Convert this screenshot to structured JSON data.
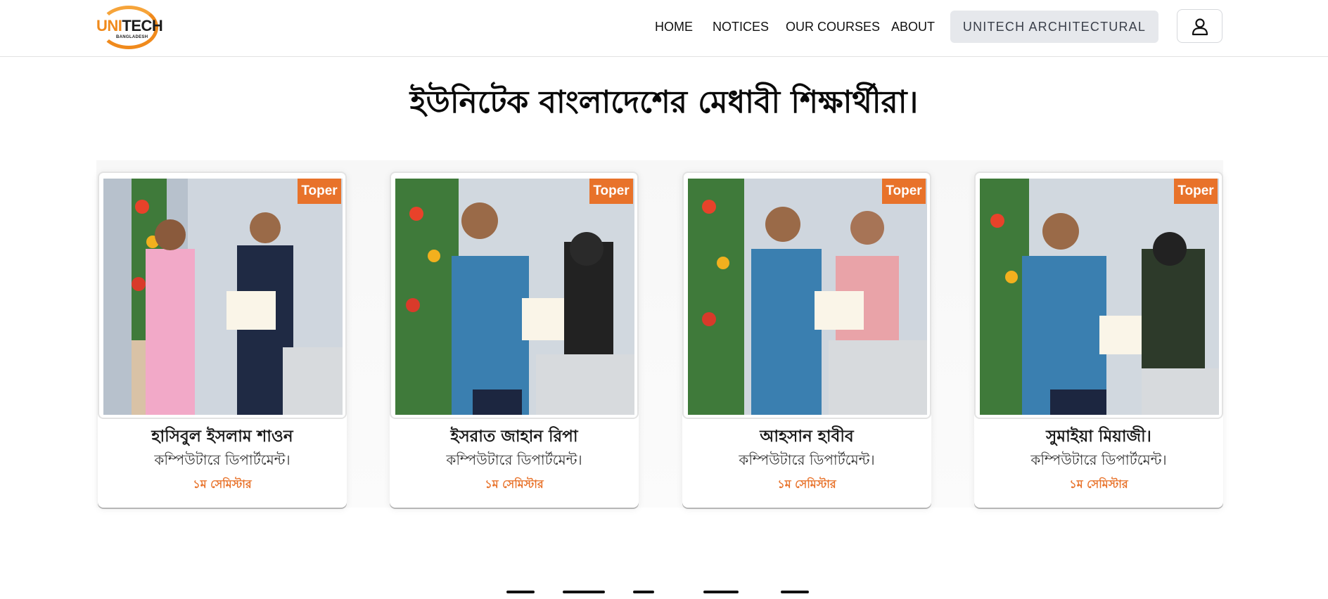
{
  "brand": {
    "logo_main_a": "UNI",
    "logo_main_b": "TECH",
    "logo_sub": "BANGLADESH"
  },
  "nav": {
    "home": "HOME",
    "notices": "NOTICES",
    "courses": "OUR COURSES",
    "about": "ABOUT",
    "architectural": "UNITECH ARCHITECTURAL",
    "user_icon": "user-icon"
  },
  "section": {
    "title": "ইউনিটেক বাংলাদেশের মেধাবী শিক্ষার্থীরা।"
  },
  "students": [
    {
      "badge": "Toper",
      "name": "হাসিবুল ইসলাম শাওন",
      "department": "কম্পিউটারে ডিপার্টমেন্ট।",
      "semester": "১ম সেমিস্টার"
    },
    {
      "badge": "Toper",
      "name": "ইসরাত জাহান রিপা",
      "department": "কম্পিউটারে ডিপার্টমেন্ট।",
      "semester": "১ম সেমিস্টার"
    },
    {
      "badge": "Toper",
      "name": "আহসান হাবীব",
      "department": "কম্পিউটারে ডিপার্টমেন্ট।",
      "semester": "১ম সেমিস্টার"
    },
    {
      "badge": "Toper",
      "name": "সুমাইয়া মিয়াজী।",
      "department": "কম্পিউটারে ডিপার্টমেন্ট।",
      "semester": "১ম সেমিস্টার"
    }
  ],
  "colors": {
    "accent": "#e8722a",
    "logo_orange": "#f08a1c",
    "button_bg": "#e6e8ec"
  }
}
